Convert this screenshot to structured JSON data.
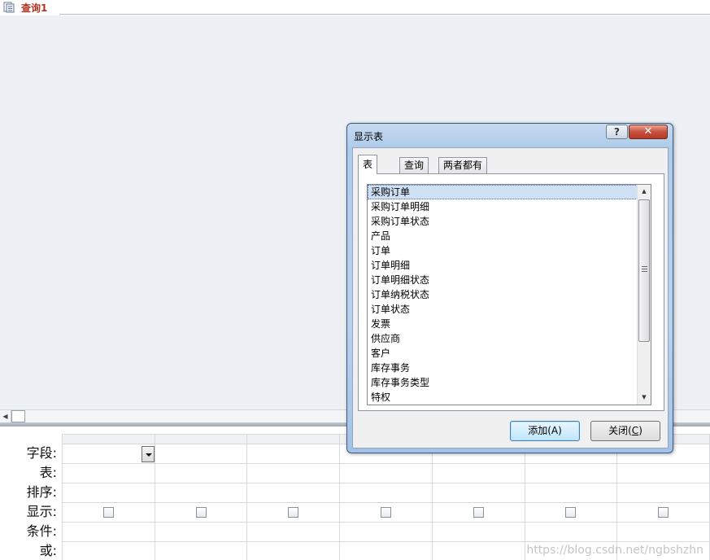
{
  "tab": {
    "title": "查询1",
    "icon": "query-icon"
  },
  "grid": {
    "row_labels": [
      "字段:",
      "表:",
      "排序:",
      "显示:",
      "条件:",
      "或:"
    ]
  },
  "watermark": "https://blog.csdn.net/ngbshzhn",
  "dialog": {
    "title": "显示表",
    "help_label": "?",
    "close_label": "✕",
    "tabs": [
      "表",
      "查询",
      "两者都有"
    ],
    "active_tab": "表",
    "tables": [
      "采购订单",
      "采购订单明细",
      "采购订单状态",
      "产品",
      "订单",
      "订单明细",
      "订单明细状态",
      "订单纳税状态",
      "订单状态",
      "发票",
      "供应商",
      "客户",
      "库存事务",
      "库存事务类型",
      "特权"
    ],
    "selected_table": "采购订单",
    "add_button": "添加(A)",
    "close_button_prefix": "关闭(",
    "close_button_key": "C",
    "close_button_suffix": ")"
  },
  "colors": {
    "tab_text": "#b4321e",
    "selection": "#cfe0f4",
    "dialog_frame": "#aecbea",
    "pane": "#edf0f4"
  }
}
